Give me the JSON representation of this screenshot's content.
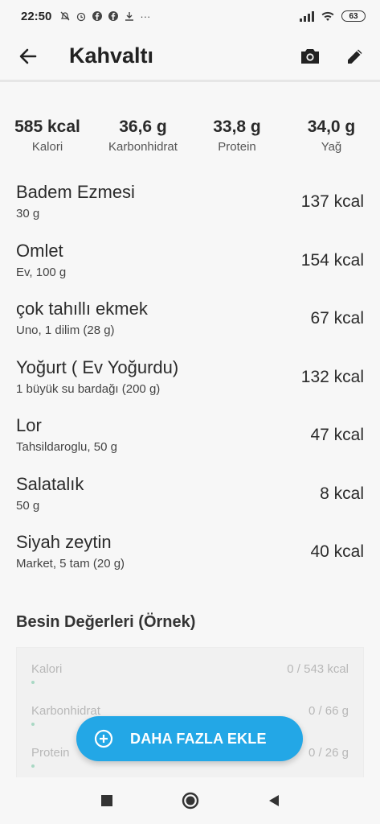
{
  "status_bar": {
    "time": "22:50",
    "dots": "···",
    "battery": "63"
  },
  "app_bar": {
    "title": "Kahvaltı"
  },
  "summary": [
    {
      "value": "585 kcal",
      "label": "Kalori"
    },
    {
      "value": "36,6 g",
      "label": "Karbonhidrat"
    },
    {
      "value": "33,8 g",
      "label": "Protein"
    },
    {
      "value": "34,0 g",
      "label": "Yağ"
    }
  ],
  "foods": [
    {
      "name": "Badem Ezmesi",
      "detail": "30 g",
      "kcal": "137 kcal"
    },
    {
      "name": "Omlet",
      "detail": "Ev, 100 g",
      "kcal": "154 kcal"
    },
    {
      "name": "çok tahıllı ekmek",
      "detail": "Uno, 1 dilim (28 g)",
      "kcal": "67 kcal"
    },
    {
      "name": "Yoğurt ( Ev Yoğurdu)",
      "detail": "1 büyük su bardağı (200 g)",
      "kcal": "132 kcal"
    },
    {
      "name": "Lor",
      "detail": "Tahsildaroglu, 50 g",
      "kcal": "47 kcal"
    },
    {
      "name": "Salatalık",
      "detail": "50 g",
      "kcal": "8 kcal"
    },
    {
      "name": "Siyah zeytin",
      "detail": "Market, 5 tam (20 g)",
      "kcal": "40 kcal"
    }
  ],
  "nutrition": {
    "title": "Besin Değerleri (Örnek)",
    "rows": [
      {
        "label": "Kalori",
        "value": "0 / 543 kcal"
      },
      {
        "label": "Karbonhidrat",
        "value": "0 / 66 g"
      },
      {
        "label": "Protein",
        "value": "0 / 26 g"
      }
    ]
  },
  "fab": {
    "label": "DAHA FAZLA EKLE"
  },
  "colors": {
    "accent": "#23a7e6",
    "text": "#222222",
    "background": "#f7f7f7"
  }
}
